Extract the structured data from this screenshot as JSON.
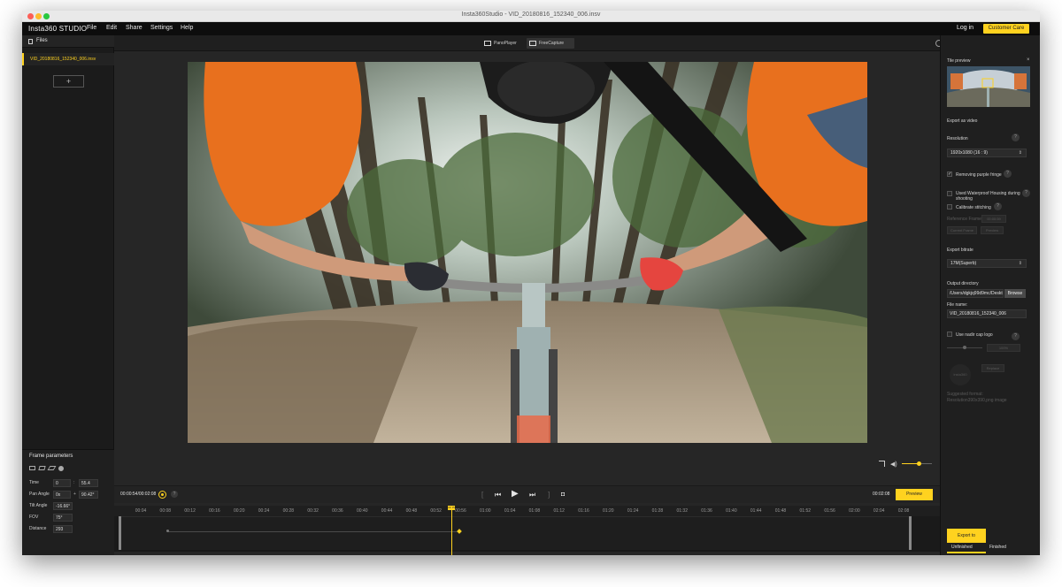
{
  "window": {
    "title": "Insta360Studio - VID_20180816_152340_006.insv"
  },
  "menubar": {
    "brand": "Insta360 STUDIO",
    "items": [
      "File",
      "Edit",
      "Share",
      "Settings",
      "Help"
    ],
    "login": "Log in",
    "customer_care": "Customer Care"
  },
  "files": {
    "header": "Files",
    "items": [
      "VID_20180816_152340_006.insv"
    ],
    "add_label": "+"
  },
  "view_tabs": [
    "PanoPlayer",
    "FreeCapture"
  ],
  "frame_params": {
    "title": "Frame parameters",
    "time": {
      "label": "Time",
      "value_a": "0",
      "value_b": "55.4"
    },
    "pan": {
      "label": "Pan Angle",
      "value_a": "0x",
      "value_b": "90.42°"
    },
    "tilt": {
      "label": "Tilt Angle",
      "value": "-16.66°"
    },
    "fov": {
      "label": "FOV",
      "value": "75°"
    },
    "distance": {
      "label": "Distance",
      "value": "293"
    }
  },
  "transport": {
    "time": "00:00:54/00:02:08",
    "end_time": "00:02:08",
    "preview": "Preview",
    "help": "?",
    "volume_level": 0.55
  },
  "timeline": {
    "ticks": [
      "00:04",
      "00:08",
      "00:12",
      "00:16",
      "00:20",
      "00:24",
      "00:28",
      "00:32",
      "00:36",
      "00:40",
      "00:44",
      "00:48",
      "00:52",
      "00:56",
      "01:00",
      "01:04",
      "01:08",
      "01:12",
      "01:16",
      "01:20",
      "01:24",
      "01:28",
      "01:32",
      "01:36",
      "01:40",
      "01:44",
      "01:48",
      "01:52",
      "01:56",
      "02:00",
      "02:04",
      "02:08"
    ],
    "playhead_label": "00:55",
    "playhead_time": 55.4,
    "duration": 128
  },
  "right_panel": {
    "tile_preview": "Tile preview",
    "close": "×",
    "export_as_video": "Export as video",
    "resolution_label": "Resolution",
    "resolution_value": "1920x1080 (16 : 9)",
    "purple_fringe": "Removing purple fringe",
    "waterproof": "Used Waterproof Housing during shooting",
    "calibrate": "Calibrate stitching",
    "reference_frame": "Reference Frame",
    "reference_time": "00:00:59",
    "current_frame": "Current Frame",
    "preview_btn": "Preview",
    "bitrate_label": "Export bitrate",
    "bitrate_value": "17M(Superb)",
    "output_dir_label": "Output directory",
    "output_dir_value": "/Users/dgkjq99d9mc/Deskt",
    "browse": "Browse",
    "file_name_label": "File name:",
    "file_name_value": "VID_20180816_152340_006",
    "nadir_label": "Use nadir cap logo",
    "nadir_size": "100%",
    "logo_label": "insta360",
    "replace": "Replace",
    "suggested_format": "Suggested format:",
    "suggested_res": "Resolution390x390,png image",
    "export_to": "Export to",
    "tabs": [
      "Unfinished",
      "Finished"
    ],
    "check_mark": "✓",
    "help": "?",
    "arrow": "⇕"
  },
  "colors": {
    "accent": "#ffd21f"
  }
}
